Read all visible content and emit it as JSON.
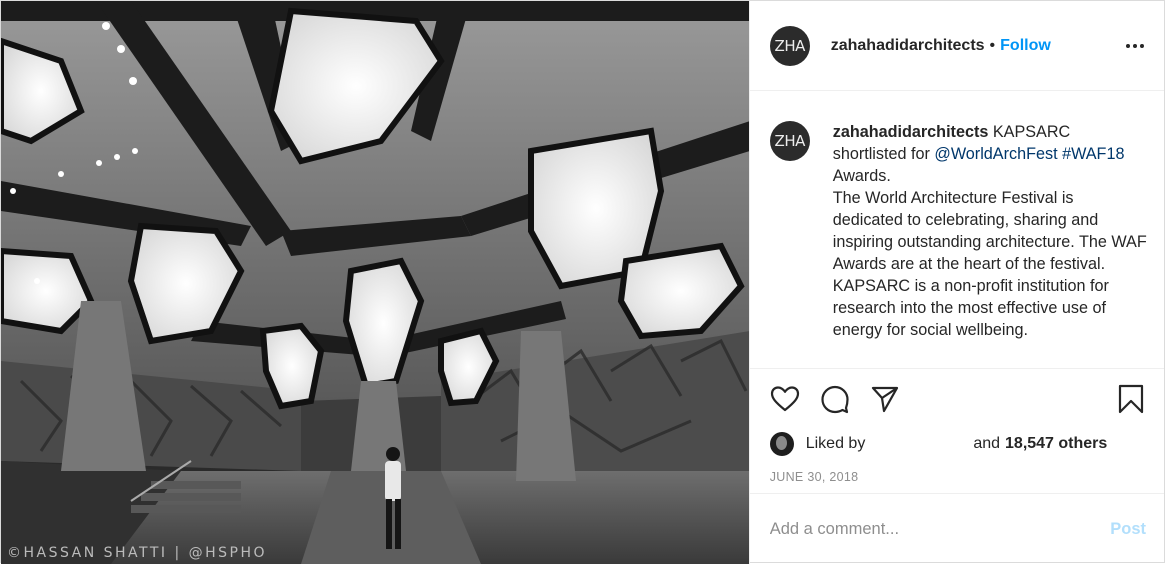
{
  "media": {
    "watermark": "©HASSAN SHATTI | @HSPHO"
  },
  "header": {
    "avatar_text": "ZHA",
    "username": "zahahadidarchitects",
    "separator": "•",
    "follow_label": "Follow"
  },
  "caption": {
    "avatar_text": "ZHA",
    "username": "zahahadidarchitects",
    "text_1": " KAPSARC shortlisted for ",
    "mention": "@WorldArchFest",
    "hashtag": "#WAF18",
    "text_2": " Awards.",
    "para_2": "The World Architecture Festival is dedicated to celebrating, sharing and inspiring outstanding architecture. The WAF Awards are at the heart of the festival.",
    "para_3": "KAPSARC is a non-profit institution for research into the most effective use of energy for social wellbeing."
  },
  "actions": {
    "like_icon": "heart-icon",
    "comment_icon": "comment-icon",
    "share_icon": "paper-plane-icon",
    "save_icon": "bookmark-icon"
  },
  "likes": {
    "prefix": "Liked by",
    "and_label": "and",
    "count": "18,547 others"
  },
  "date": "JUNE 30, 2018",
  "comment_box": {
    "placeholder": "Add a comment...",
    "post_label": "Post"
  },
  "colors": {
    "link": "#0095f6",
    "post_disabled": "#b2dffc",
    "muted": "#8e8e8e"
  }
}
